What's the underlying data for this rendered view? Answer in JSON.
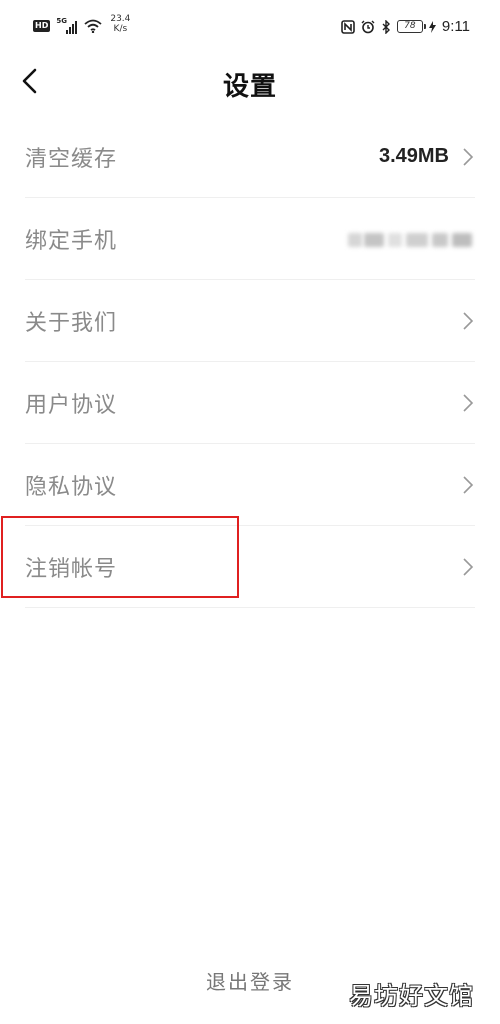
{
  "status_bar": {
    "hd": "HD",
    "signal_label": "5G",
    "net_speed_value": "23.4",
    "net_speed_unit": "K/s",
    "battery": "78",
    "time": "9:11"
  },
  "header": {
    "title": "设置"
  },
  "settings": {
    "items": [
      {
        "label": "清空缓存",
        "value": "3.49MB",
        "has_chevron": true
      },
      {
        "label": "绑定手机",
        "value_hidden": true,
        "has_chevron": false
      },
      {
        "label": "关于我们",
        "has_chevron": true
      },
      {
        "label": "用户协议",
        "has_chevron": true
      },
      {
        "label": "隐私协议",
        "has_chevron": true
      },
      {
        "label": "注销帐号",
        "has_chevron": true,
        "highlighted": true
      }
    ]
  },
  "logout_label": "退出登录",
  "watermark": "易坊好文馆",
  "colors": {
    "highlight": "#e02020",
    "label": "#8a8a8a",
    "title": "#111111"
  }
}
